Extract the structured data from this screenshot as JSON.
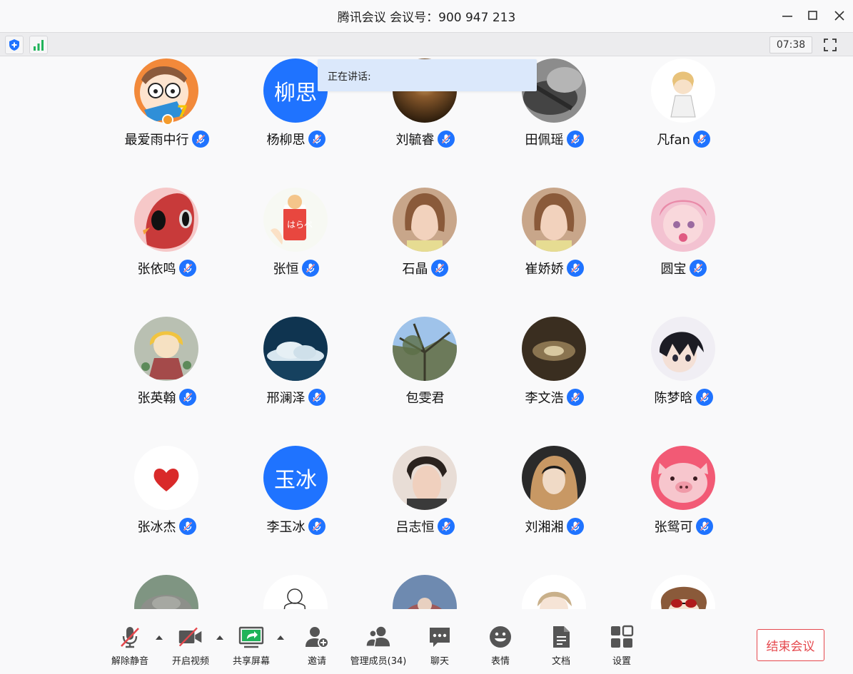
{
  "window": {
    "title": "腾讯会议 会议号：900 947 213"
  },
  "status": {
    "timer": "07:38",
    "icons": [
      "shield-icon",
      "signal-icon",
      "fullscreen-icon"
    ]
  },
  "speaking": {
    "label": "正在讲话:"
  },
  "colors": {
    "accent": "#1f73ff",
    "end_button": "#e5484d",
    "background": "#f9f9fa"
  },
  "participants": [
    {
      "name": "最爱雨中行",
      "mic": true,
      "avatar": "cartoon-face"
    },
    {
      "name": "杨柳思",
      "mic": true,
      "avatar_text": "柳思"
    },
    {
      "name": "刘毓睿",
      "mic": true,
      "avatar": "sunset-photo"
    },
    {
      "name": "田佩瑶",
      "mic": true,
      "avatar": "cat-photo"
    },
    {
      "name": "凡fan",
      "mic": true,
      "avatar": "anime-girl"
    },
    {
      "name": "张依鸣",
      "mic": true,
      "avatar": "red-cartoon"
    },
    {
      "name": "张恒",
      "mic": true,
      "avatar": "milk-carton-cat"
    },
    {
      "name": "石晶",
      "mic": true,
      "avatar": "girl-photo"
    },
    {
      "name": "崔娇娇",
      "mic": true,
      "avatar": "girl-photo"
    },
    {
      "name": "圆宝",
      "mic": true,
      "avatar": "pink-anime"
    },
    {
      "name": "张英翰",
      "mic": true,
      "avatar": "anime-art"
    },
    {
      "name": "邢澜泽",
      "mic": true,
      "avatar": "cloud-photo"
    },
    {
      "name": "包雯君",
      "mic": false,
      "avatar": "tree-photo"
    },
    {
      "name": "李文浩",
      "mic": true,
      "avatar": "dark-photo"
    },
    {
      "name": "陈梦晗",
      "mic": true,
      "avatar": "anime-boy"
    },
    {
      "name": "张冰杰",
      "mic": true,
      "avatar": "heart"
    },
    {
      "name": "李玉冰",
      "mic": true,
      "avatar_text": "玉冰"
    },
    {
      "name": "吕志恒",
      "mic": true,
      "avatar": "boy-photo"
    },
    {
      "name": "刘湘湘",
      "mic": true,
      "avatar": "hooded-photo"
    },
    {
      "name": "张鸳可",
      "mic": true,
      "avatar": "pink-pig"
    },
    {
      "name": "",
      "mic": false,
      "avatar": "hippo-photo"
    },
    {
      "name": "",
      "mic": false,
      "avatar": "line-drawing"
    },
    {
      "name": "",
      "mic": false,
      "avatar": "blue-photo"
    },
    {
      "name": "",
      "mic": false,
      "avatar": "anime-boy-2"
    },
    {
      "name": "",
      "mic": false,
      "avatar": "sunglasses-cartoon"
    }
  ],
  "toolbar": {
    "unmute": "解除静音",
    "video": "开启视频",
    "share": "共享屏幕",
    "invite": "邀请",
    "members": "管理成员(34)",
    "chat": "聊天",
    "emoji": "表情",
    "docs": "文档",
    "settings": "设置",
    "end": "结束会议"
  }
}
